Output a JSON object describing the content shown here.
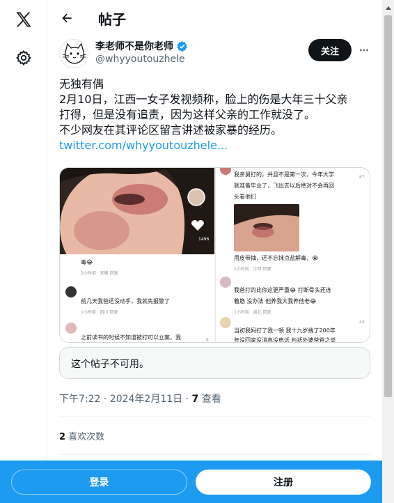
{
  "header": {
    "title": "帖子"
  },
  "author": {
    "display_name": "李老师不是你老师",
    "handle": "@whyyoutouzhele",
    "verified": true,
    "follow_label": "关注"
  },
  "tweet": {
    "lines": [
      "无独有偶",
      "2月10日，江西一女子发视频称，脸上的伤是大年三十父亲",
      "打得，但是没有追责，因为这样父亲的工作就没了。",
      "不少网友在其评论区留言讲述被家暴的经历。"
    ],
    "link": "twitter.com/whyyoutouzhele..."
  },
  "media": {
    "video_likes": "1496",
    "comments": [
      {
        "text": "毒😂",
        "meta": "2小时前 · 安徽  回复"
      },
      {
        "text": "前几天我爸还没动手，我就先报警了",
        "meta": "1小时前 · 四川  回复"
      },
      {
        "text": "之前读书的时候不知道被打可以立案，我",
        "meta": "",
        "likes": "8"
      },
      {
        "text": "我亲舅打的，并且不是第一次，今年大学",
        "meta": "",
        "likes": "87"
      },
      {
        "text": "就准备毕业了，飞出去以后绝对不会再回",
        "meta": ""
      },
      {
        "text": "头看他们",
        "meta": ""
      },
      {
        "text": "用皮带抽，还不忘抹点盐解毒，😭",
        "meta": "1小时前 · 江西  回复"
      },
      {
        "text": "我爸打的比你这更严重😂 打断骨头还连",
        "meta": ""
      },
      {
        "text": "着筋 没办法 他养我大我养他老😂",
        "meta": "1小时前 · 湖北  回复"
      },
      {
        "text": "当初我妈打了我一顿 我十九岁揣了200年",
        "meta": "",
        "likes": "44"
      },
      {
        "text": "年没回家没消息没电话 包括外婆爸爸之类",
        "meta": ""
      }
    ]
  },
  "unavailable_notice": "这个帖子不可用。",
  "meta": {
    "time": "下午7:22 · 2024年2月11日 · ",
    "views_count": "7",
    "views_label": " 查看"
  },
  "likes": {
    "count": "2",
    "label": " 喜欢次数"
  },
  "bottom": {
    "login_label": "登录",
    "signup_label": "注册"
  },
  "colors": {
    "accent": "#1d9bf0",
    "text": "#0f1419",
    "muted": "#536471"
  }
}
